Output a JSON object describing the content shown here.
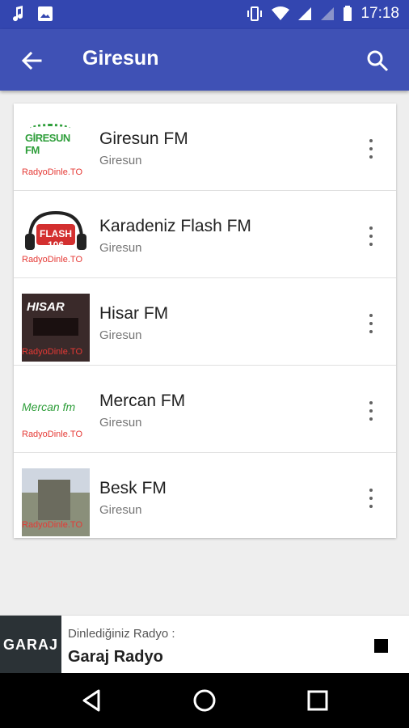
{
  "status_bar": {
    "time": "17:18"
  },
  "app_bar": {
    "title": "Giresun"
  },
  "stations": [
    {
      "name": "Giresun FM",
      "city": "Giresun",
      "logo_caption": "RadyoDinle.TO",
      "logo_brand": "GİRESUN FM"
    },
    {
      "name": "Karadeniz Flash FM",
      "city": "Giresun",
      "logo_caption": "RadyoDinle.TO",
      "logo_brand": "FLASH 106"
    },
    {
      "name": "Hisar FM",
      "city": "Giresun",
      "logo_caption": "RadyoDinle.TO",
      "logo_brand": "HISAR"
    },
    {
      "name": "Mercan FM",
      "city": "Giresun",
      "logo_caption": "RadyoDinle.TO",
      "logo_brand": "Mercan fm"
    },
    {
      "name": "Besk FM",
      "city": "Giresun",
      "logo_caption": "RadyoDinle.TO",
      "logo_brand": ""
    }
  ],
  "player": {
    "label": "Dinlediğiniz Radyo :",
    "station": "Garaj Radyo",
    "logo_text": "GARAJ"
  },
  "colors": {
    "status_bar": "#3346b0",
    "app_bar": "#3f51b5",
    "caption_red": "#e53935"
  }
}
